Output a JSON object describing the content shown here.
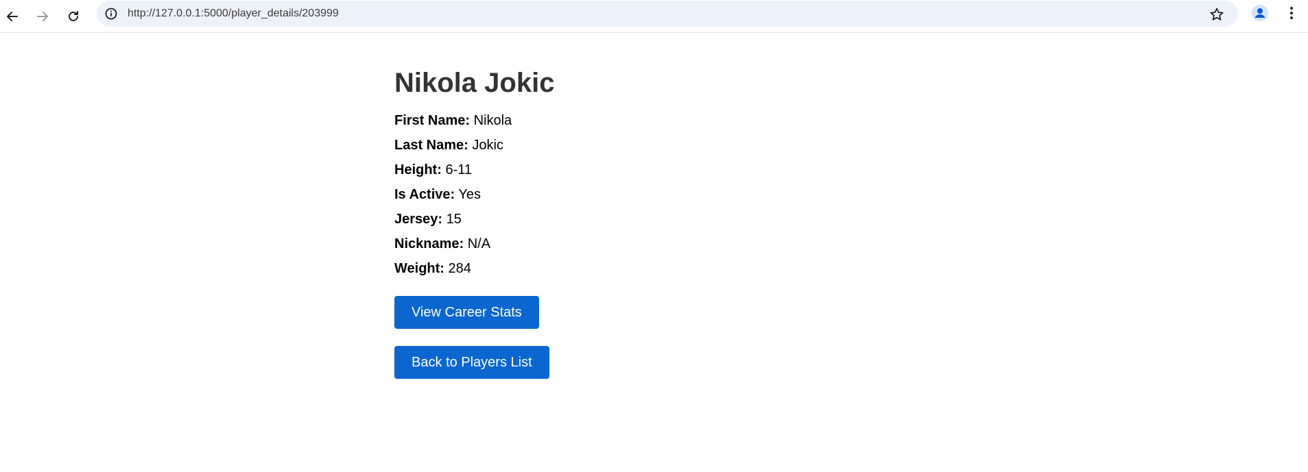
{
  "browser": {
    "url": "http://127.0.0.1:5000/player_details/203999",
    "icons": {
      "back": "arrow-left-icon",
      "forward": "arrow-right-icon",
      "reload": "reload-icon",
      "info": "info-icon",
      "bookmark": "star-icon",
      "profile": "person-icon",
      "menu": "more-vertical-icon"
    }
  },
  "player": {
    "name": "Nikola Jokic",
    "details": [
      {
        "label": "First Name:",
        "value": "Nikola"
      },
      {
        "label": "Last Name:",
        "value": "Jokic"
      },
      {
        "label": "Height:",
        "value": "6-11"
      },
      {
        "label": "Is Active:",
        "value": "Yes"
      },
      {
        "label": "Jersey:",
        "value": "15"
      },
      {
        "label": "Nickname:",
        "value": "N/A"
      },
      {
        "label": "Weight:",
        "value": "284"
      }
    ]
  },
  "actions": {
    "career_stats_label": "View Career Stats",
    "back_label": "Back to Players List"
  },
  "colors": {
    "button_bg": "#0b66d0",
    "heading": "#333333",
    "omnibox_bg": "#edf1f9"
  }
}
